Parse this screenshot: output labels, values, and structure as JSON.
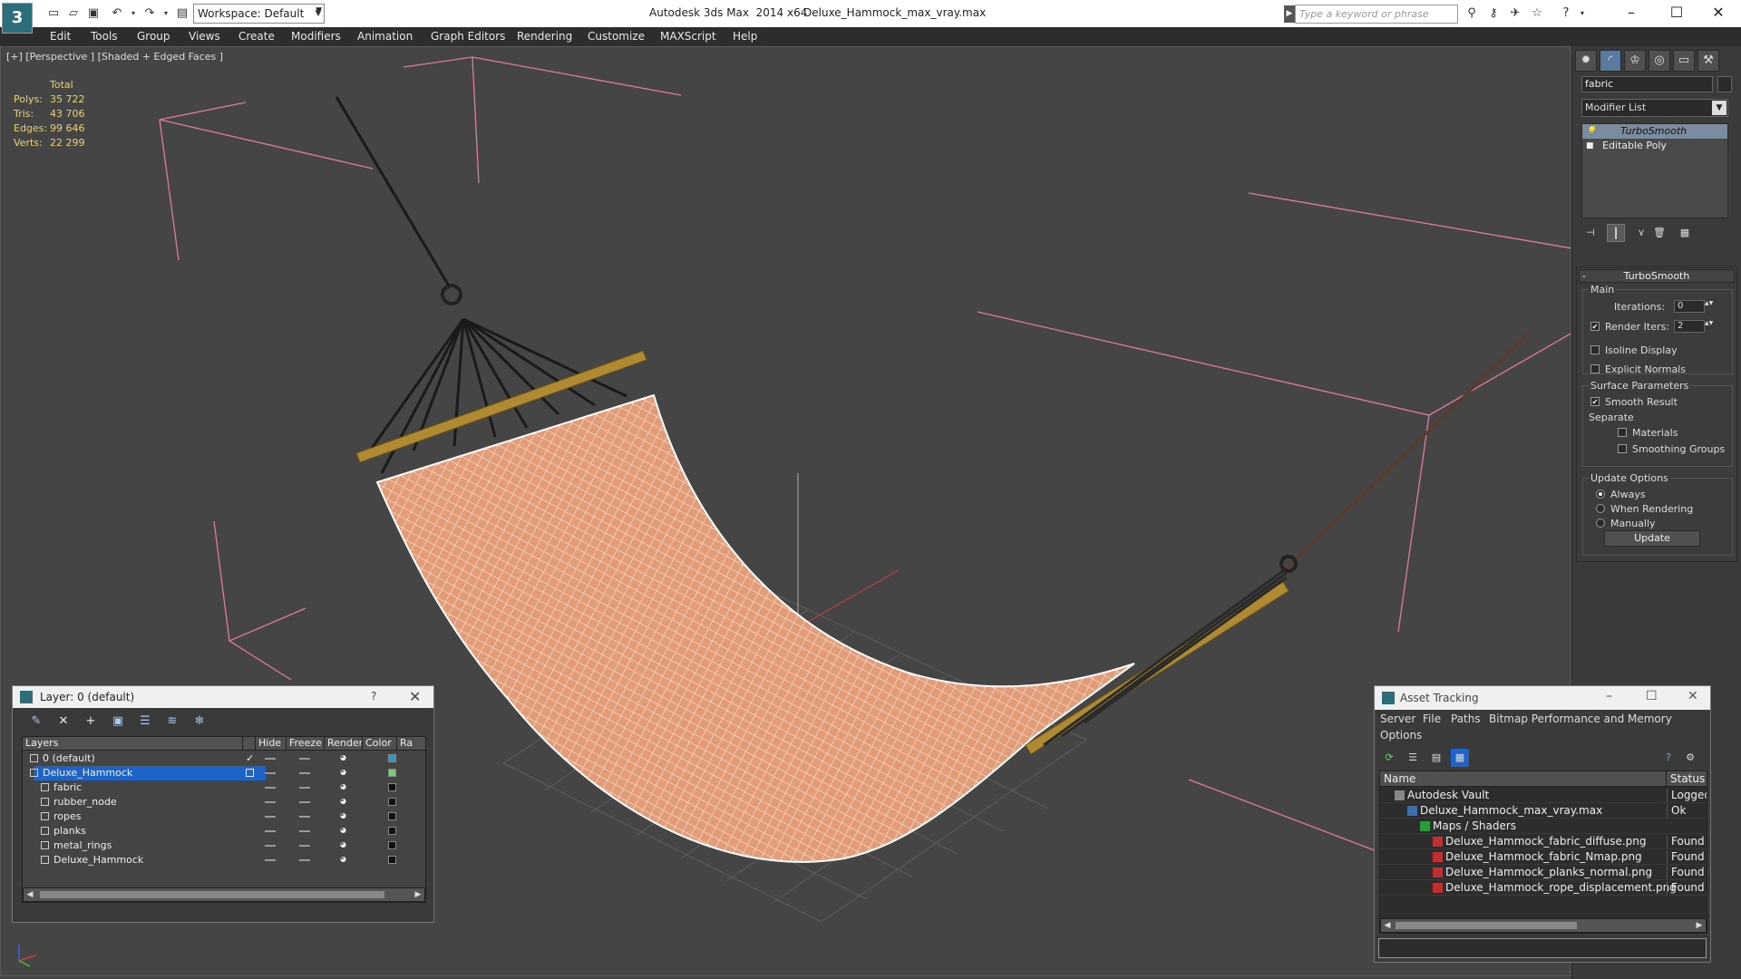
{
  "titlebar": {
    "app_title": "Autodesk 3ds Max  2014 x64",
    "file_name": "Deluxe_Hammock_max_vray.max",
    "workspace": "Workspace: Default",
    "search_placeholder": "Type a keyword or phrase"
  },
  "menu": [
    "Edit",
    "Tools",
    "Group",
    "Views",
    "Create",
    "Modifiers",
    "Animation",
    "Graph Editors",
    "Rendering",
    "Customize",
    "MAXScript",
    "Help"
  ],
  "viewport": {
    "label": "[+] [Perspective ] [Shaded + Edged Faces ]",
    "stats_header": "Total",
    "stats": [
      {
        "label": "Polys:",
        "value": "35 722"
      },
      {
        "label": "Tris:",
        "value": "43 706"
      },
      {
        "label": "Edges:",
        "value": "99 646"
      },
      {
        "label": "Verts:",
        "value": "22 299"
      }
    ]
  },
  "command_panel": {
    "object_name": "fabric",
    "modifier_list": "Modifier List",
    "stack": [
      "TurboSmooth",
      "Editable Poly"
    ],
    "rollout_title": "TurboSmooth",
    "main_group": "Main",
    "iterations_label": "Iterations:",
    "iterations_value": "0",
    "render_iters_label": "Render Iters:",
    "render_iters_value": "2",
    "isoline_label": "Isoline Display",
    "explicit_normals_label": "Explicit Normals",
    "surface_group": "Surface Parameters",
    "smooth_result_label": "Smooth Result",
    "separate_label": "Separate",
    "materials_label": "Materials",
    "smoothing_groups_label": "Smoothing Groups",
    "update_group": "Update Options",
    "always_label": "Always",
    "when_rendering_label": "When Rendering",
    "manually_label": "Manually",
    "update_button": "Update"
  },
  "layer_dialog": {
    "title": "Layer: 0 (default)",
    "help": "?",
    "columns": [
      "Layers",
      "Hide",
      "Freeze",
      "Render",
      "Color",
      "Ra"
    ],
    "rows": [
      {
        "name": "0 (default)",
        "color": "#1e9bd2"
      },
      {
        "name": "Deluxe_Hammock",
        "color": "#6fd26f"
      },
      {
        "name": "fabric",
        "color": "#111111"
      },
      {
        "name": "rubber_node",
        "color": "#111111"
      },
      {
        "name": "ropes",
        "color": "#111111"
      },
      {
        "name": "planks",
        "color": "#111111"
      },
      {
        "name": "metal_rings",
        "color": "#111111"
      },
      {
        "name": "Deluxe_Hammock",
        "color": "#111111"
      }
    ]
  },
  "asset_dialog": {
    "title": "Asset Tracking",
    "menu": [
      "Server",
      "File",
      "Paths",
      "Bitmap Performance and Memory",
      "Options"
    ],
    "columns": [
      "Name",
      "Status"
    ],
    "rows": [
      {
        "name": "Autodesk Vault",
        "status": "Logged"
      },
      {
        "name": "Deluxe_Hammock_max_vray.max",
        "status": "Ok"
      },
      {
        "name": "Maps / Shaders",
        "status": ""
      },
      {
        "name": "Deluxe_Hammock_fabric_diffuse.png",
        "status": "Found"
      },
      {
        "name": "Deluxe_Hammock_fabric_Nmap.png",
        "status": "Found"
      },
      {
        "name": "Deluxe_Hammock_planks_normal.png",
        "status": "Found"
      },
      {
        "name": "Deluxe_Hammock_rope_displacement.png",
        "status": "Found"
      }
    ]
  },
  "colors": {
    "menubar": "#2d2d2d",
    "viewport_bg": "#454545",
    "selection": "#1e64c8",
    "stats_text": "#e8d27a",
    "fabric": "#e8a07a",
    "wood": "#b08a30"
  }
}
